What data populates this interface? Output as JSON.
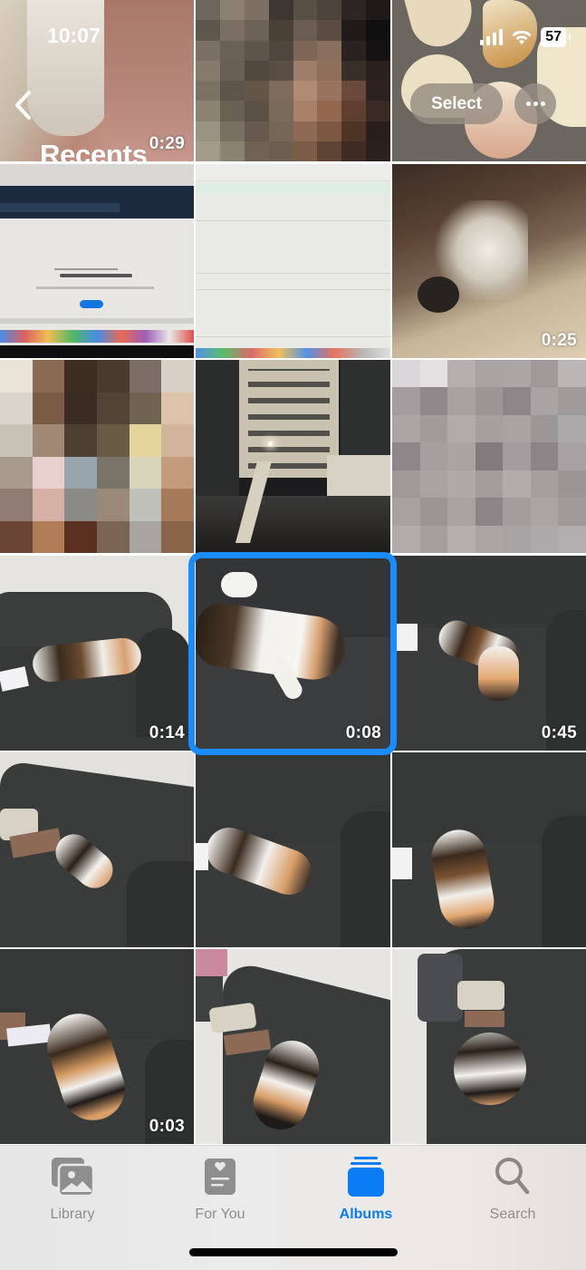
{
  "status_bar": {
    "time": "10:07",
    "battery_level": "57",
    "icons": [
      "cellular-signal-icon",
      "wifi-icon",
      "battery-icon"
    ]
  },
  "header": {
    "back_icon": "chevron-left-icon",
    "title": "Recents",
    "select_label": "Select",
    "more_icon": "ellipsis-icon"
  },
  "grid": {
    "rows": [
      [
        {
          "kind": "video",
          "subject": "pet paw on pink surface",
          "duration": "0:29"
        },
        {
          "kind": "photo",
          "subject": "pixelated portrait"
        },
        {
          "kind": "photo",
          "subject": "sliced apples"
        }
      ],
      [
        {
          "kind": "photo",
          "subject": "laptop screen: Sorry, Flights Not Found."
        },
        {
          "kind": "photo",
          "subject": "laptop screen: flight search results"
        },
        {
          "kind": "video",
          "subject": "dog sleeping on blanket",
          "duration": "0:25"
        }
      ],
      [
        {
          "kind": "photo",
          "subject": "pixelated image"
        },
        {
          "kind": "photo",
          "subject": "apartment courtyard at night"
        },
        {
          "kind": "photo",
          "subject": "pixelated gray image"
        }
      ],
      [
        {
          "kind": "video",
          "subject": "cat on couch",
          "duration": "0:14"
        },
        {
          "kind": "video",
          "subject": "cat lying on couch close-up",
          "duration": "0:08",
          "selected": true
        },
        {
          "kind": "video",
          "subject": "cat on back on couch",
          "duration": "0:45"
        }
      ],
      [
        {
          "kind": "photo",
          "subject": "cat on couch with pillow"
        },
        {
          "kind": "photo",
          "subject": "cat rolling on couch"
        },
        {
          "kind": "photo",
          "subject": "cat on back on couch"
        }
      ],
      [
        {
          "kind": "video",
          "subject": "cat on couch with books",
          "duration": "0:03"
        },
        {
          "kind": "photo",
          "subject": "cat on couch with pillow and books"
        },
        {
          "kind": "photo",
          "subject": "cat on couch near blanket"
        }
      ]
    ]
  },
  "tabbar": {
    "tabs": [
      {
        "label": "Library",
        "icon": "photo-library-icon",
        "active": false
      },
      {
        "label": "For You",
        "icon": "for-you-icon",
        "active": false
      },
      {
        "label": "Albums",
        "icon": "albums-icon",
        "active": true
      },
      {
        "label": "Search",
        "icon": "search-icon",
        "active": false
      }
    ]
  },
  "colors": {
    "accent": "#0a7cf4",
    "selection_ring": "#1a8cff",
    "inactive_tab": "#8e8e8e"
  }
}
